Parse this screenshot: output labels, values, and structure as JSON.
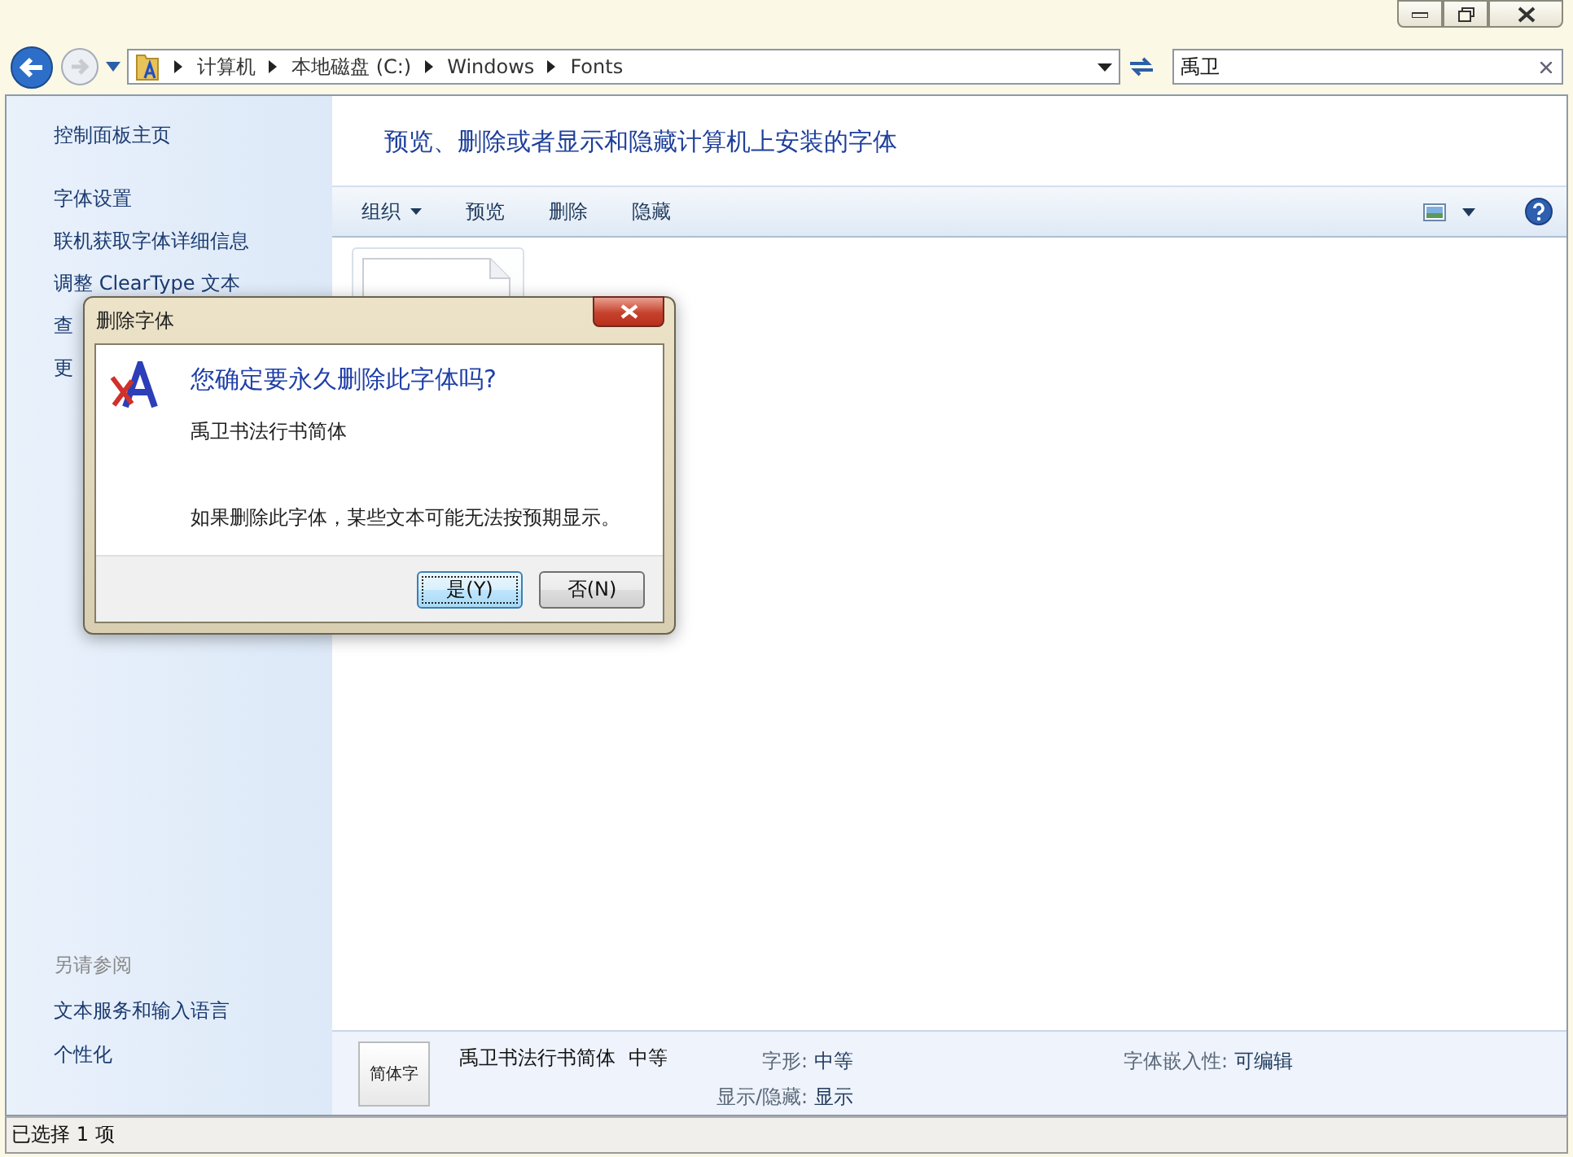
{
  "address_bar": {
    "path": [
      "计算机",
      "本地磁盘 (C:)",
      "Windows",
      "Fonts"
    ]
  },
  "search": {
    "value": "禹卫"
  },
  "sidebar": {
    "items": [
      "控制面板主页",
      "字体设置",
      "联机获取字体详细信息",
      "调整 ClearType 文本",
      "查",
      "更"
    ],
    "see_also_title": "另请参阅",
    "see_also": [
      "文本服务和输入语言",
      "个性化"
    ]
  },
  "heading": "预览、删除或者显示和隐藏计算机上安装的字体",
  "toolbar": [
    {
      "label": "组织",
      "kind": "menu"
    },
    {
      "label": "预览",
      "kind": "button"
    },
    {
      "label": "删除",
      "kind": "button"
    },
    {
      "label": "隐藏",
      "kind": "button"
    }
  ],
  "details": {
    "thumbnail_text": "简体字",
    "name": "禹卫书法行书简体",
    "weight": "中等",
    "fields": [
      {
        "label": "字形:",
        "value": "中等"
      },
      {
        "label": "显示/隐藏:",
        "value": "显示"
      },
      {
        "label": "字体嵌入性:",
        "value": "可编辑"
      }
    ]
  },
  "status_bar": "已选择 1 项",
  "dialog": {
    "title": "删除字体",
    "question": "您确定要永久删除此字体吗?",
    "font_name": "禹卫书法行书简体",
    "message": "如果删除此字体，某些文本可能无法按预期显示。",
    "buttons": [
      {
        "label": "是(Y)",
        "default": true
      },
      {
        "label": "否(N)",
        "default": false
      }
    ]
  }
}
